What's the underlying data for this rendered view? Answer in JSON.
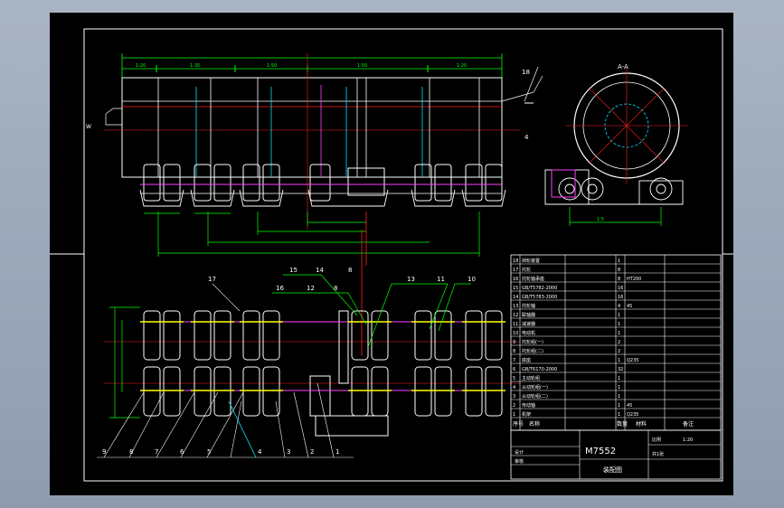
{
  "drawing": {
    "title_block_name": "M7552",
    "title_block_sub": "装配图",
    "sheet_label": "装配图",
    "colors": {
      "background": "#000000",
      "outline": "#ffffff",
      "dimension": "#00ff00",
      "center_line": "#ff2020",
      "body": "#ffff00",
      "cyan": "#00e5ff",
      "magenta": "#ff40ff"
    }
  },
  "front_view": {
    "dimensions": [
      "1:20",
      "1:35",
      "1:50",
      "1:50",
      "1:20"
    ],
    "callouts": [
      "18",
      "4"
    ]
  },
  "side_view": {
    "title": "A-A",
    "dimension": "1:5"
  },
  "plan_view": {
    "top_callouts": [
      "15",
      "14",
      "8",
      "13",
      "11",
      "10"
    ],
    "sub_callouts": [
      "16",
      "12",
      "8"
    ],
    "left_callout": "17",
    "bottom_callouts": [
      "9",
      "8",
      "7",
      "6",
      "5",
      "4",
      "3",
      "2",
      "1"
    ]
  },
  "parts_table": {
    "rows": [
      {
        "no": "18",
        "name": "挡轮装置",
        "qty": "1",
        "material": ""
      },
      {
        "no": "17",
        "name": "托轮",
        "qty": "8",
        "material": ""
      },
      {
        "no": "16",
        "name": "托轮轴承座",
        "qty": "8",
        "material": "HT200"
      },
      {
        "no": "15",
        "name": "GB/T5782-2000",
        "qty": "16",
        "material": ""
      },
      {
        "no": "14",
        "name": "GB/T5783-2000",
        "qty": "16",
        "material": ""
      },
      {
        "no": "13",
        "name": "托轮轴",
        "qty": "4",
        "material": "45"
      },
      {
        "no": "12",
        "name": "联轴器",
        "qty": "1",
        "material": ""
      },
      {
        "no": "11",
        "name": "减速器",
        "qty": "1",
        "material": ""
      },
      {
        "no": "10",
        "name": "电动机",
        "qty": "1",
        "material": ""
      },
      {
        "no": "9",
        "name": "托轮组(一)",
        "qty": "2",
        "material": ""
      },
      {
        "no": "8",
        "name": "托轮组(二)",
        "qty": "2",
        "material": ""
      },
      {
        "no": "7",
        "name": "底座",
        "qty": "1",
        "material": "Q235"
      },
      {
        "no": "6",
        "name": "GB/T6170-2000",
        "qty": "32",
        "material": ""
      },
      {
        "no": "5",
        "name": "主动轮组",
        "qty": "1",
        "material": ""
      },
      {
        "no": "4",
        "name": "从动轮组(一)",
        "qty": "1",
        "material": ""
      },
      {
        "no": "3",
        "name": "从动轮组(二)",
        "qty": "1",
        "material": ""
      },
      {
        "no": "2",
        "name": "传动轴",
        "qty": "1",
        "material": "45"
      },
      {
        "no": "1",
        "name": "机架",
        "qty": "1",
        "material": "Q235"
      }
    ],
    "header": {
      "no": "序号",
      "name": "名称",
      "qty": "数量",
      "material": "材料",
      "note": "备注"
    }
  },
  "title_block": {
    "scale_label": "比例",
    "scale": "1:20",
    "sheet": "共1张",
    "designer": "设计",
    "checker": "审核"
  }
}
